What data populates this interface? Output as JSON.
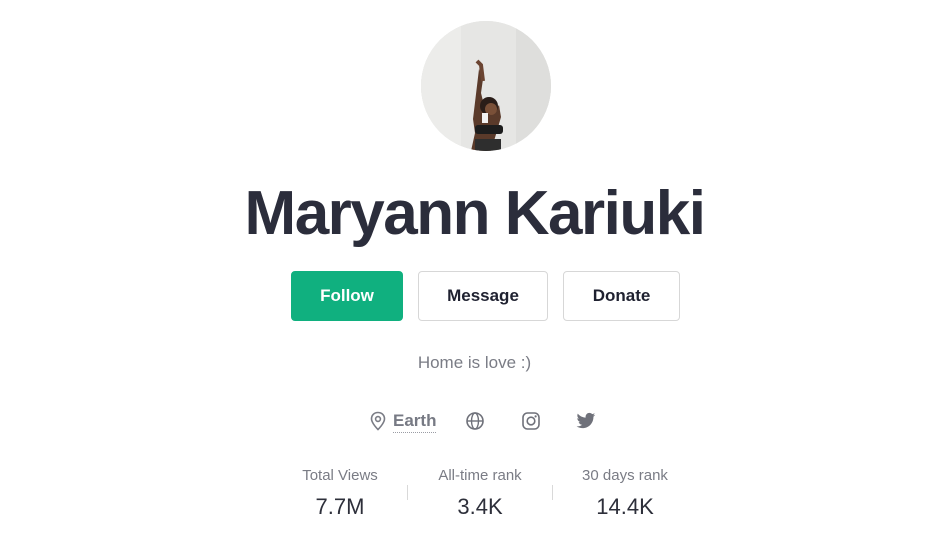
{
  "profile": {
    "name": "Maryann Kariuki",
    "bio": "Home is love :)",
    "location": "Earth"
  },
  "actions": {
    "follow_label": "Follow",
    "message_label": "Message",
    "donate_label": "Donate"
  },
  "socials": [
    "globe-icon",
    "instagram-icon",
    "twitter-icon"
  ],
  "stats": [
    {
      "label": "Total Views",
      "value": "7.7M"
    },
    {
      "label": "All-time rank",
      "value": "3.4K"
    },
    {
      "label": "30 days rank",
      "value": "14.4K"
    }
  ],
  "colors": {
    "accent": "#10b07f",
    "text": "#2b2d3b",
    "muted": "#7a7c85"
  }
}
